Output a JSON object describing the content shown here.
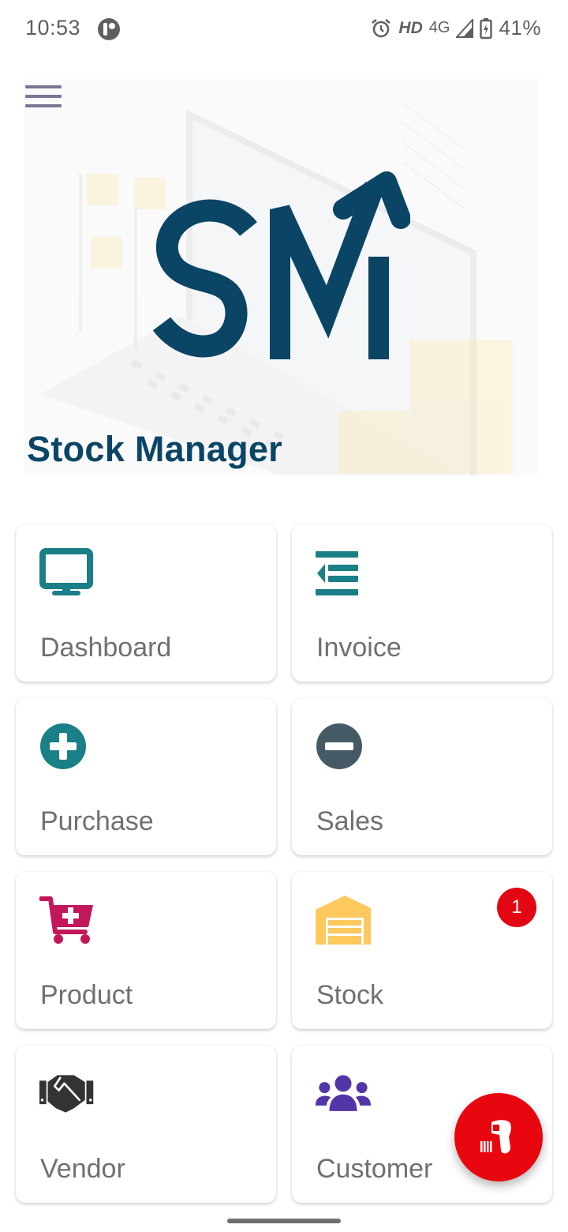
{
  "status_bar": {
    "time": "10:53",
    "hd": "HD",
    "network": "4G",
    "battery": "41%",
    "icons": [
      "app-notification-icon",
      "alarm-icon",
      "signal-icon",
      "battery-charging-icon"
    ]
  },
  "header": {
    "menu_icon": "hamburger-menu-icon",
    "logo_text": "SM",
    "app_title": "Stock Manager"
  },
  "colors": {
    "brand": "#0b4566",
    "teal": "#1a7f87",
    "slate": "#455a64",
    "magenta": "#c2185b",
    "amber": "#fdc85d",
    "dark": "#333333",
    "purple": "#5236a8",
    "red": "#e8070f"
  },
  "menu": [
    {
      "label": "Dashboard",
      "icon": "desktop-monitor-icon"
    },
    {
      "label": "Invoice",
      "icon": "list-outdent-icon"
    },
    {
      "label": "Purchase",
      "icon": "plus-circle-icon"
    },
    {
      "label": "Sales",
      "icon": "minus-circle-icon"
    },
    {
      "label": "Product",
      "icon": "cart-plus-icon"
    },
    {
      "label": "Stock",
      "icon": "warehouse-icon",
      "badge": "1"
    },
    {
      "label": "Vendor",
      "icon": "handshake-icon"
    },
    {
      "label": "Customer",
      "icon": "users-icon"
    }
  ],
  "fab": {
    "icon": "barcode-scanner-icon"
  }
}
